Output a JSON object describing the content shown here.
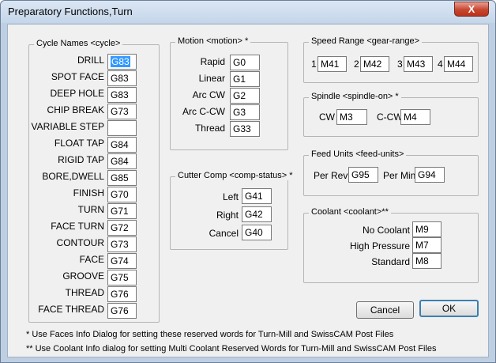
{
  "window": {
    "title": "Preparatory Functions,Turn",
    "close_glyph": "X"
  },
  "cycle": {
    "title": "Cycle Names <cycle>",
    "items": [
      {
        "label": "DRILL",
        "value": "G83"
      },
      {
        "label": "SPOT FACE",
        "value": "G83"
      },
      {
        "label": "DEEP HOLE",
        "value": "G83"
      },
      {
        "label": "CHIP BREAK",
        "value": "G73"
      },
      {
        "label": "VARIABLE STEP",
        "value": ""
      },
      {
        "label": "FLOAT TAP",
        "value": "G84"
      },
      {
        "label": "RIGID TAP",
        "value": "G84"
      },
      {
        "label": "BORE,DWELL",
        "value": "G85"
      },
      {
        "label": "FINISH",
        "value": "G70"
      },
      {
        "label": "TURN",
        "value": "G71"
      },
      {
        "label": "FACE TURN",
        "value": "G72"
      },
      {
        "label": "CONTOUR",
        "value": "G73"
      },
      {
        "label": "FACE",
        "value": "G74"
      },
      {
        "label": "GROOVE",
        "value": "G75"
      },
      {
        "label": "THREAD",
        "value": "G76"
      },
      {
        "label": "FACE THREAD",
        "value": "G76"
      }
    ]
  },
  "motion": {
    "title": "Motion <motion> *",
    "items": [
      {
        "label": "Rapid",
        "value": "G0"
      },
      {
        "label": "Linear",
        "value": "G1"
      },
      {
        "label": "Arc CW",
        "value": "G2"
      },
      {
        "label": "Arc C-CW",
        "value": "G3"
      },
      {
        "label": "Thread",
        "value": "G33"
      }
    ]
  },
  "cutter": {
    "title": "Cutter Comp <comp-status> *",
    "items": [
      {
        "label": "Left",
        "value": "G41"
      },
      {
        "label": "Right",
        "value": "G42"
      },
      {
        "label": "Cancel",
        "value": "G40"
      }
    ]
  },
  "speed": {
    "title": "Speed Range <gear-range>",
    "items": [
      {
        "label": "1",
        "value": "M41"
      },
      {
        "label": "2",
        "value": "M42"
      },
      {
        "label": "3",
        "value": "M43"
      },
      {
        "label": "4",
        "value": "M44"
      }
    ]
  },
  "spindle": {
    "title": "Spindle <spindle-on> *",
    "items": [
      {
        "label": "CW",
        "value": "M3"
      },
      {
        "label": "C-CW",
        "value": "M4"
      }
    ]
  },
  "feed": {
    "title": "Feed Units <feed-units>",
    "items": [
      {
        "label": "Per Rev",
        "value": "G95"
      },
      {
        "label": "Per Min",
        "value": "G94"
      }
    ]
  },
  "coolant": {
    "title": "Coolant <coolant>**",
    "items": [
      {
        "label": "No Coolant",
        "value": "M9"
      },
      {
        "label": "High Pressure",
        "value": "M7"
      },
      {
        "label": "Standard",
        "value": "M8"
      }
    ]
  },
  "buttons": {
    "cancel": "Cancel",
    "ok": "OK"
  },
  "notes": {
    "one": "* Use Faces Info Dialog for setting these reserved words for Turn-Mill and SwissCAM Post Files",
    "two": "** Use Coolant Info dialog for setting Multi Coolant Reserved Words for Turn-Mill and SwissCAM Post Files"
  }
}
